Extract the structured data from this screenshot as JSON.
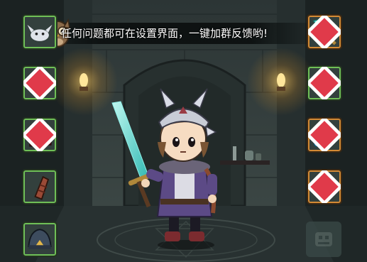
{
  "hint_banner": {
    "text": "任何问题都可在设置界面，一键加群反馈哟!"
  },
  "equipment_left": [
    {
      "name": "companion-slot",
      "icon": "companion-creature-icon"
    },
    {
      "name": "armor-slot",
      "icon": "purple-tunic-icon"
    },
    {
      "name": "boots-slot",
      "icon": "red-boots-icon"
    },
    {
      "name": "bracer-slot",
      "icon": "leather-bracer-icon"
    },
    {
      "name": "helmet-slot",
      "icon": "dark-helmet-icon"
    }
  ],
  "equipment_right": [
    {
      "name": "weapon-slot",
      "icon": "crystal-sword-icon"
    },
    {
      "name": "ring-slot",
      "icon": "spiked-ring-icon"
    },
    {
      "name": "necklace-slot",
      "icon": "gold-necklace-icon"
    },
    {
      "name": "charm-slot",
      "icon": "flame-charm-icon"
    }
  ],
  "colors": {
    "wall": "#2f3a3a",
    "floor": "#1c2222",
    "torch": "#ffd36a",
    "crystal": "#5fe6d8",
    "slot_green": "#6fbf57",
    "slot_orange": "#d38a35",
    "gem": "#e03a4a"
  }
}
